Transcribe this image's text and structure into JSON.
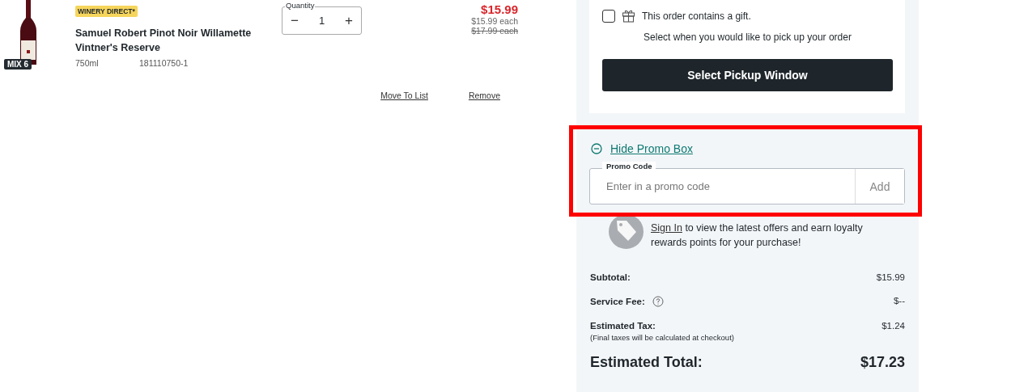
{
  "cart_item": {
    "badge": "WINERY DIRECT*",
    "mix_label": "MIX 6",
    "name": "Samuel Robert Pinot Noir Willamette Vintner's Reserve",
    "size": "750ml",
    "sku": "181110750-1",
    "quantity": {
      "label": "Quantity",
      "value": "1",
      "decrement": "−",
      "increment": "+"
    },
    "price": "$15.99",
    "unit_price": "$15.99 each",
    "original_price": "$17.99 each",
    "actions": [
      "Move To List",
      "Remove"
    ]
  },
  "order_panel": {
    "gift": {
      "label": "This order contains a gift.",
      "checked": false
    },
    "pickup_prompt": "Select when you would like to pick up your order",
    "pickup_button": "Select Pickup Window",
    "promo": {
      "toggle": "Hide Promo Box",
      "expanded": true,
      "field_label": "Promo Code",
      "placeholder": "Enter in a promo code",
      "add_button": "Add"
    },
    "sign_in": {
      "link": "Sign In",
      "text": " to view the latest offers and earn loyalty rewards points for your purchase!"
    },
    "summary": [
      {
        "kind": "line",
        "label": "Subtotal:",
        "value": "$15.99",
        "help": false
      },
      {
        "kind": "line",
        "label": "Service Fee:",
        "value": "$--",
        "help": true
      },
      {
        "kind": "line",
        "label": "Estimated Tax:",
        "value": "$1.24",
        "help": false,
        "note": "(Final taxes will be calculated at checkout)"
      },
      {
        "kind": "total",
        "label": "Estimated Total:",
        "value": "$17.23",
        "help": false
      }
    ]
  }
}
